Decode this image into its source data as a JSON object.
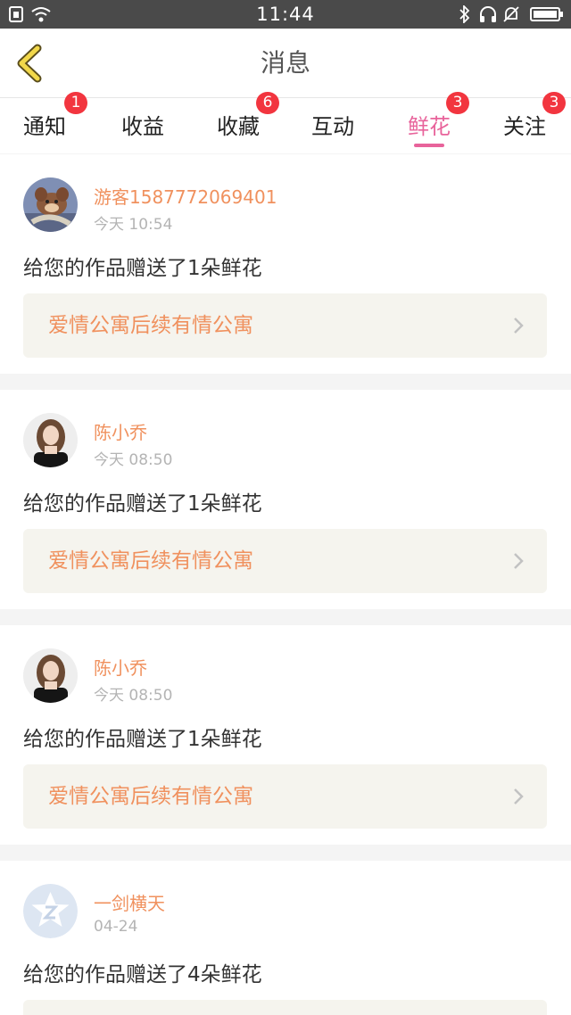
{
  "status_bar": {
    "time": "11:44"
  },
  "header": {
    "title": "消息"
  },
  "tabs": [
    {
      "label": "通知",
      "badge": "1"
    },
    {
      "label": "收益",
      "badge": ""
    },
    {
      "label": "收藏",
      "badge": "6"
    },
    {
      "label": "互动",
      "badge": ""
    },
    {
      "label": "鲜花",
      "badge": "3"
    },
    {
      "label": "关注",
      "badge": "3"
    }
  ],
  "active_tab": "鲜花",
  "colors": {
    "accent_pink": "#e8639b",
    "name_orange": "#f0915e",
    "badge_red": "#f2353f"
  },
  "messages": [
    {
      "user": "游客1587772069401",
      "time": "今天 10:54",
      "text": "给您的作品赠送了1朵鲜花",
      "work": "爱情公寓后续有情公寓",
      "avatar": "cartoon-avatar"
    },
    {
      "user": "陈小乔",
      "time": "今天 08:50",
      "text": "给您的作品赠送了1朵鲜花",
      "work": "爱情公寓后续有情公寓",
      "avatar": "photo-avatar"
    },
    {
      "user": "陈小乔",
      "time": "今天 08:50",
      "text": "给您的作品赠送了1朵鲜花",
      "work": "爱情公寓后续有情公寓",
      "avatar": "photo-avatar"
    },
    {
      "user": "一剑横天",
      "time": "04-24",
      "text": "给您的作品赠送了4朵鲜花",
      "work": "",
      "avatar": "default-qq-avatar"
    }
  ]
}
